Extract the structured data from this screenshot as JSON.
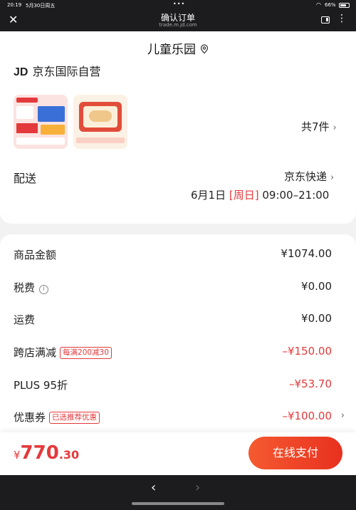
{
  "status": {
    "time": "20:19",
    "date": "5月30日周五",
    "dots": "•••",
    "battery": "66%"
  },
  "browser": {
    "title": "确认订单",
    "url": "trade.m.jd.com",
    "close_glyph": "✕",
    "menu_glyph": "⋮"
  },
  "store": {
    "name": "儿童乐园",
    "location_icon": "location-pin-icon"
  },
  "order": {
    "seller_logo": "JD",
    "seller_name": "京东国际自营",
    "item_count": "共7件",
    "chevron": "›"
  },
  "shipping": {
    "label": "配送",
    "method": "京东快递",
    "date": "6月1日",
    "weekday": "[周日]",
    "time": "09:00–21:00"
  },
  "summary": {
    "rows": [
      {
        "label": "商品金额",
        "value": "¥1074.00"
      },
      {
        "label": "税费",
        "value": "¥0.00"
      },
      {
        "label": "运费",
        "value": "¥0.00"
      },
      {
        "label": "跨店满减",
        "tag": "每满200减30",
        "value": "–¥150.00"
      },
      {
        "label": "PLUS 95折",
        "value": "–¥53.70"
      },
      {
        "label": "优惠券",
        "tag": "已选推荐优惠",
        "value": "–¥100.00"
      }
    ]
  },
  "footer": {
    "currency": "¥",
    "total_int": "770",
    "total_dec": ".30",
    "pay_label": "在线支付"
  },
  "nav": {
    "back": "‹",
    "forward": "›"
  },
  "colors": {
    "accent": "#e4393c",
    "chrome": "#1c1c1e"
  }
}
